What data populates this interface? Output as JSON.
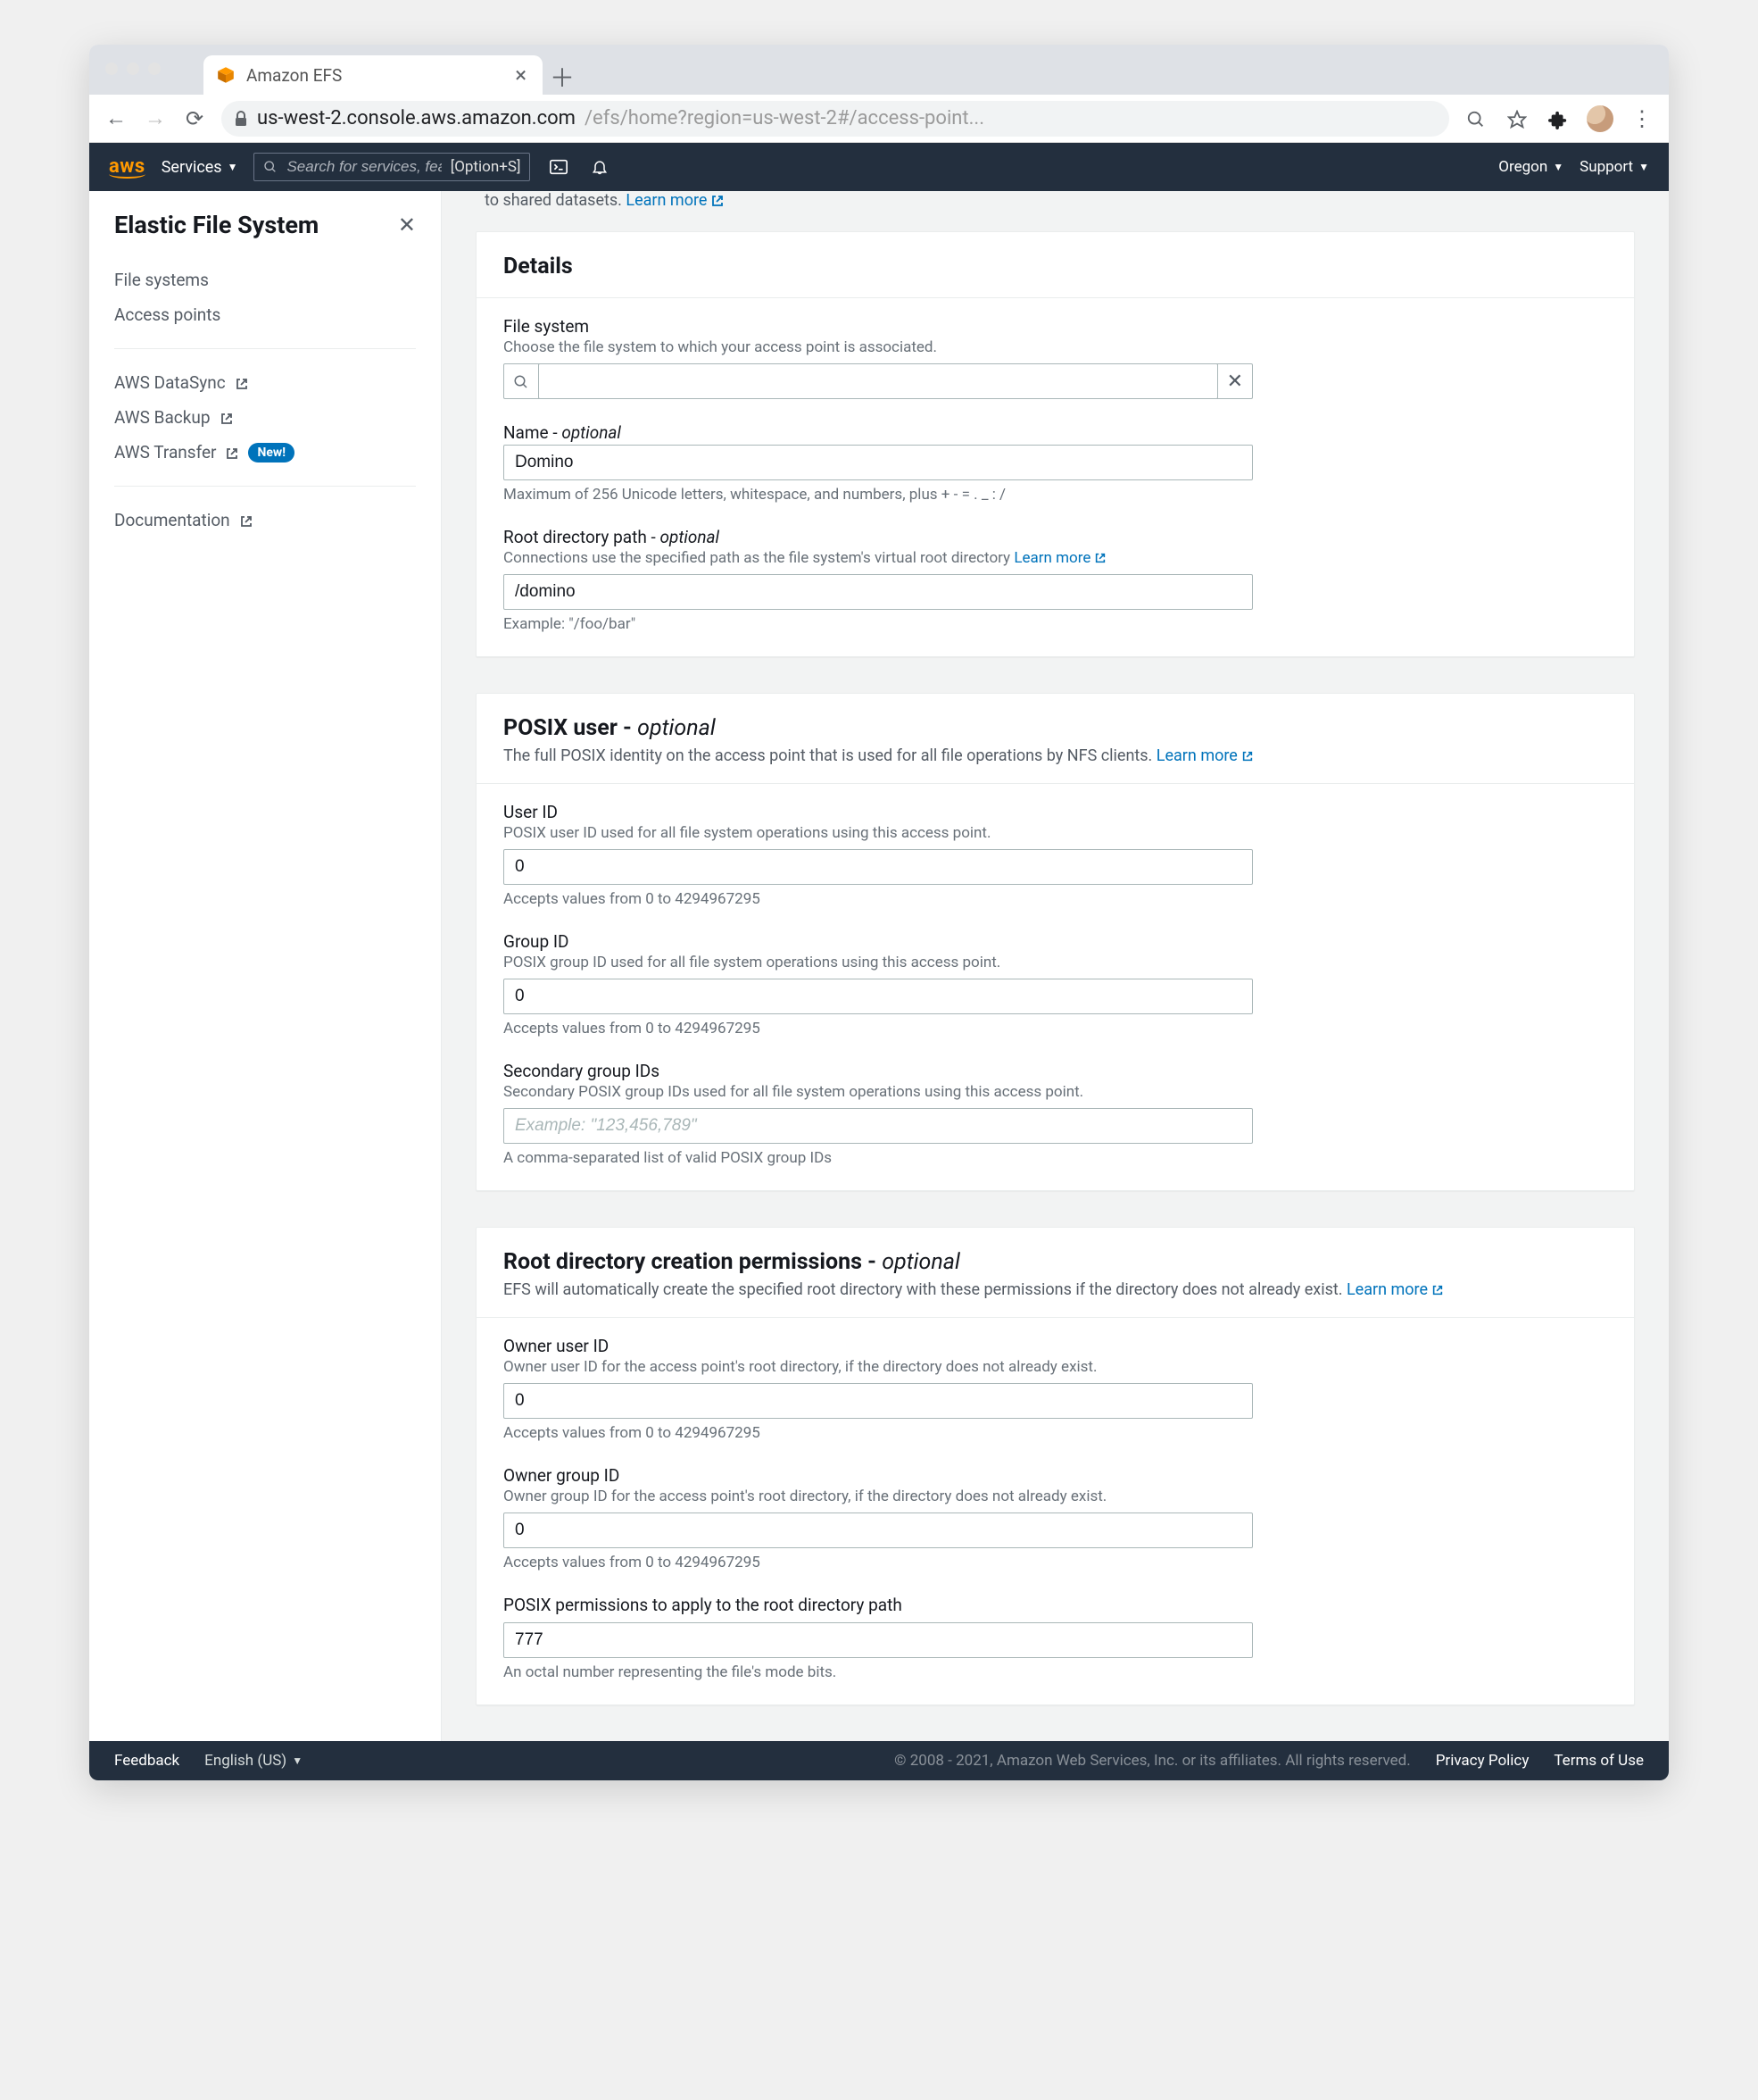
{
  "browser": {
    "tab_title": "Amazon EFS",
    "url_host": "us-west-2.console.aws.amazon.com",
    "url_path": "/efs/home?region=us-west-2#/access-point...",
    "search_placeholder": "Search for services, features",
    "search_shortcut": "[Option+S]"
  },
  "topnav": {
    "services": "Services",
    "region": "Oregon",
    "support": "Support"
  },
  "sidebar": {
    "title": "Elastic File System",
    "links": {
      "filesystems": "File systems",
      "accesspoints": "Access points",
      "datasync": "AWS DataSync",
      "backup": "AWS Backup",
      "transfer": "AWS Transfer",
      "documentation": "Documentation"
    },
    "new_badge": "New!"
  },
  "banner": {
    "trail": "to shared datasets.",
    "learn_more": "Learn more"
  },
  "details": {
    "heading": "Details",
    "filesystem": {
      "label": "File system",
      "desc": "Choose the file system to which your access point is associated."
    },
    "name": {
      "label": "Name - ",
      "optional": "optional",
      "value": "Domino",
      "hint": "Maximum of 256 Unicode letters, whitespace, and numbers, plus + - = . _ : /"
    },
    "rootdir": {
      "label": "Root directory path - ",
      "optional": "optional",
      "desc_pre": "Connections use the specified path as the file system's virtual root directory ",
      "learn_more": "Learn more",
      "value": "/domino",
      "hint": "Example: \"/foo/bar\""
    }
  },
  "posix": {
    "heading": "POSIX user - ",
    "optional": "optional",
    "desc_pre": "The full POSIX identity on the access point that is used for all file operations by NFS clients. ",
    "learn_more": "Learn more",
    "user_id": {
      "label": "User ID",
      "desc": "POSIX user ID used for all file system operations using this access point.",
      "value": "0",
      "hint": "Accepts values from 0 to 4294967295"
    },
    "group_id": {
      "label": "Group ID",
      "desc": "POSIX group ID used for all file system operations using this access point.",
      "value": "0",
      "hint": "Accepts values from 0 to 4294967295"
    },
    "secondary": {
      "label": "Secondary group IDs",
      "desc": "Secondary POSIX group IDs used for all file system operations using this access point.",
      "placeholder": "Example: \"123,456,789\"",
      "hint": "A comma-separated list of valid POSIX group IDs"
    }
  },
  "rootperms": {
    "heading": "Root directory creation permissions - ",
    "optional": "optional",
    "desc_pre": "EFS will automatically create the specified root directory with these permissions if the directory does not already exist. ",
    "learn_more": "Learn more",
    "owner_user": {
      "label": "Owner user ID",
      "desc": "Owner user ID for the access point's root directory, if the directory does not already exist.",
      "value": "0",
      "hint": "Accepts values from 0 to 4294967295"
    },
    "owner_group": {
      "label": "Owner group ID",
      "desc": "Owner group ID for the access point's root directory, if the directory does not already exist.",
      "value": "0",
      "hint": "Accepts values from 0 to 4294967295"
    },
    "permissions": {
      "label": "POSIX permissions to apply to the root directory path",
      "value": "777",
      "hint": "An octal number representing the file's mode bits."
    }
  },
  "footer": {
    "feedback": "Feedback",
    "language": "English (US)",
    "copyright": "© 2008 - 2021, Amazon Web Services, Inc. or its affiliates. All rights reserved.",
    "privacy": "Privacy Policy",
    "terms": "Terms of Use"
  }
}
